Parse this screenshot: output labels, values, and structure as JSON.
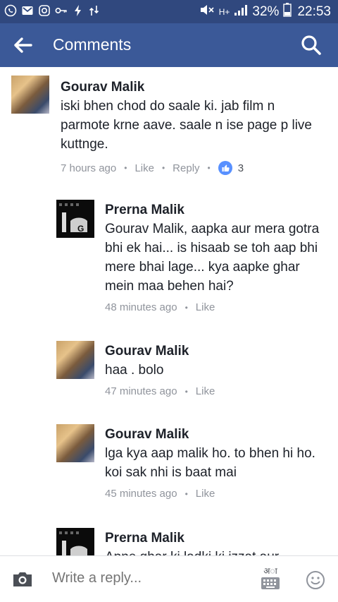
{
  "status_bar": {
    "battery": "32%",
    "time": "22:53",
    "network": "H+"
  },
  "app_bar": {
    "title": "Comments"
  },
  "comments": [
    {
      "name": "Gourav Malik",
      "text": "iski bhen chod do saale ki. jab film n parmote krne aave.    saale n ise page p live kuttnge.",
      "time": "7 hours ago",
      "like": "Like",
      "reply": "Reply",
      "reactions": "3"
    },
    {
      "name": "Prerna Malik",
      "text": "Gourav Malik, aapka aur mera gotra bhi ek hai... is hisaab se toh aap bhi mere bhai lage... kya aapke ghar mein maa behen hai?",
      "time": "48 minutes ago",
      "like": "Like"
    },
    {
      "name": "Gourav Malik",
      "text": "haa .  bolo",
      "time": "47 minutes ago",
      "like": "Like"
    },
    {
      "name": "Gourav Malik",
      "text": "lga kya aap malik ho. to bhen hi ho. koi sak nhi is baat mai",
      "time": "45 minutes ago",
      "like": "Like"
    },
    {
      "name": "Prerna Malik",
      "text": "Apne ghar ki ladki ki izzat aur"
    }
  ],
  "composer": {
    "placeholder": "Write a reply...",
    "keyboard_label": "अा"
  },
  "colors": {
    "status_bar": "#30487e",
    "app_bar": "#3b5998",
    "like_badge": "#5890ff"
  }
}
